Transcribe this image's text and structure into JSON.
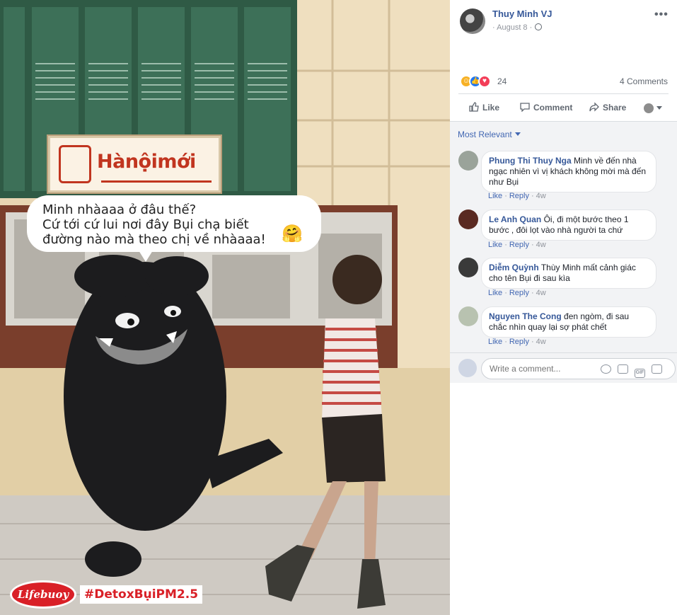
{
  "photo": {
    "bubble_text": [
      "Minh nhàaaa ở đâu thế?",
      "Cứ tới cứ lui nơi đây Bụi chạ biết",
      "đường nào mà theo chị về nhàaaa!"
    ],
    "bubble_emoji": "🤗",
    "sign_text": "Hànộimới",
    "brand_logo": "Lifebuoy",
    "hashtag": "#DetoxBụiPM2.5"
  },
  "post": {
    "author": "Thuy Minh VJ",
    "date": "August 8",
    "date_separator": "·",
    "more_icon": "more-icon",
    "privacy_icon": "globe-icon",
    "reaction_icons": [
      "haha-icon",
      "like-icon",
      "love-icon"
    ],
    "reaction_count": "24",
    "comments_count": "4 Comments"
  },
  "actions": {
    "like": "Like",
    "comment": "Comment",
    "share": "Share"
  },
  "comments_section": {
    "sort_label": "Most Relevant",
    "items": [
      {
        "name": "Phung Thi Thuy Nga",
        "text": "Minh về đến nhà ngạc nhiên vì vị khách không mời mà đến như Bụi",
        "like": "Like",
        "reply": "Reply",
        "time": "4w",
        "avatar_color": "#9aa39a"
      },
      {
        "name": "Le Anh Quan",
        "text": "Ôi, đi một bước theo 1 bước , đôi lọt vào nhà người ta chứ",
        "like": "Like",
        "reply": "Reply",
        "time": "4w",
        "avatar_color": "#5a2a22"
      },
      {
        "name": "Diễm Quỳnh",
        "text": "Thùy Minh mất cảnh giác cho tên Bụi đi sau kìa",
        "like": "Like",
        "reply": "Reply",
        "time": "4w",
        "avatar_color": "#3a3a3a"
      },
      {
        "name": "Nguyen The Cong",
        "text": "đen ngòm, đi sau chắc nhìn quay lại sợ phát chết",
        "like": "Like",
        "reply": "Reply",
        "time": "4w",
        "avatar_color": "#b8c2b0"
      }
    ],
    "write_placeholder": "Write a comment...",
    "write_icons": [
      "emoji-icon",
      "camera-icon",
      "gif-icon",
      "sticker-icon"
    ],
    "gif_label": "GIF"
  },
  "colors": {
    "link_blue": "#365899",
    "action_gray": "#606770",
    "panel_bg": "#f2f3f5"
  }
}
